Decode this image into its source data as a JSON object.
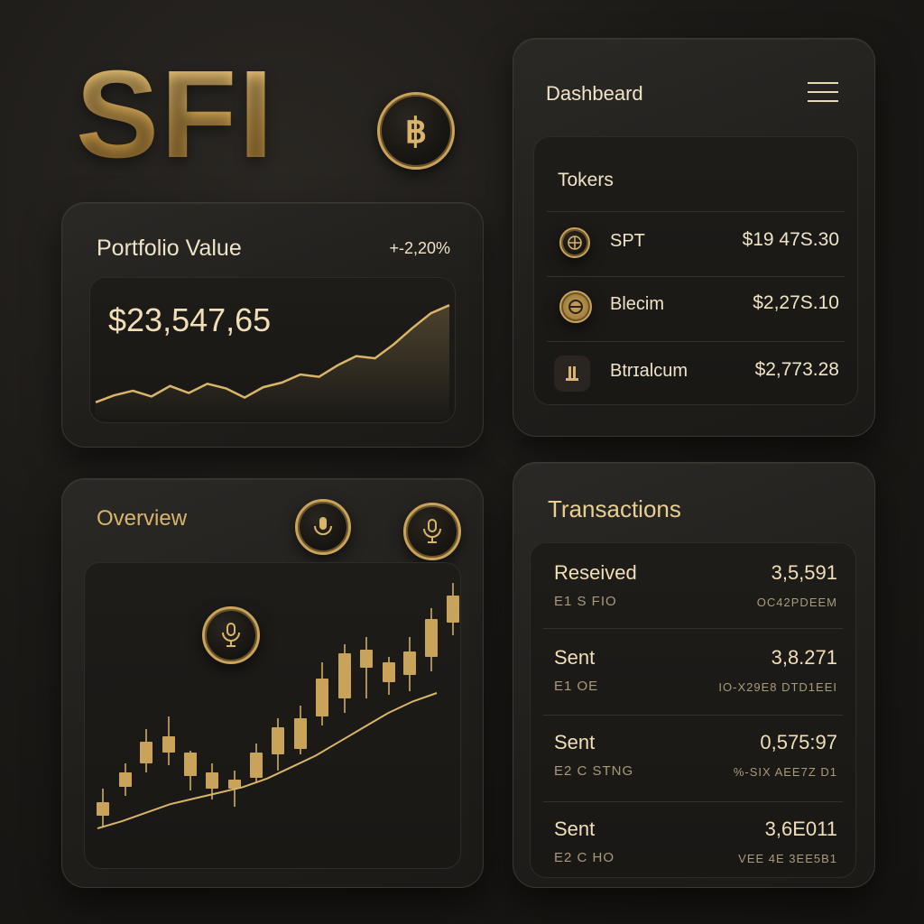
{
  "brand": {
    "logo_text": "SFI"
  },
  "portfolio": {
    "title": "Portfolio Value",
    "change": "+-2,20%",
    "value": "$23,547,65",
    "chart_data": {
      "type": "line",
      "series": [
        {
          "values": [
            8,
            14,
            18,
            13,
            22,
            16,
            24,
            20,
            12,
            21,
            25,
            32,
            30,
            40,
            48,
            46,
            58,
            72,
            85,
            92
          ]
        }
      ]
    }
  },
  "dashboard": {
    "title": "Dashbeard",
    "menu_icon": "hamburger-menu-icon",
    "tokens_title": "Tokers",
    "tokens": [
      {
        "name": "SPT",
        "value": "$19 47S.30",
        "icon": "coin-grid-icon"
      },
      {
        "name": "Blecim",
        "value": "$2,27S.10",
        "icon": "coin-ring-icon"
      },
      {
        "name": "Btrɪalcum",
        "value": "$2,773.28",
        "icon": "coin-bar-icon"
      }
    ]
  },
  "overview": {
    "title": "Overview",
    "icons": [
      "mic-icon",
      "mic-stand-icon",
      "mic-center-icon"
    ],
    "chart_data": {
      "type": "line",
      "series": [
        {
          "values": [
            5,
            10,
            16,
            22,
            26,
            30,
            34,
            40,
            48,
            56,
            66,
            76,
            86,
            94,
            100
          ]
        }
      ]
    }
  },
  "transactions": {
    "title": "Transactions",
    "items": [
      {
        "type": "Reseived",
        "amount": "3,5,591",
        "sub": "E1 S FIO",
        "code": "OC42PDEEM"
      },
      {
        "type": "Sent",
        "amount": "3,8.271",
        "sub": "E1 OE",
        "code": "IO-X29E8 DTD1EEI"
      },
      {
        "type": "Sent",
        "amount": "0,575:97",
        "sub": "E2 C STNG",
        "code": "%-SIX AEE7Z D1"
      },
      {
        "type": "Sent",
        "amount": "3,6E011",
        "sub": "E2 C HO",
        "code": "VEE 4E 3EE5B1"
      }
    ]
  },
  "colors": {
    "accent": "#d9b56b",
    "background": "#1c1a17",
    "card": "#24221f"
  }
}
